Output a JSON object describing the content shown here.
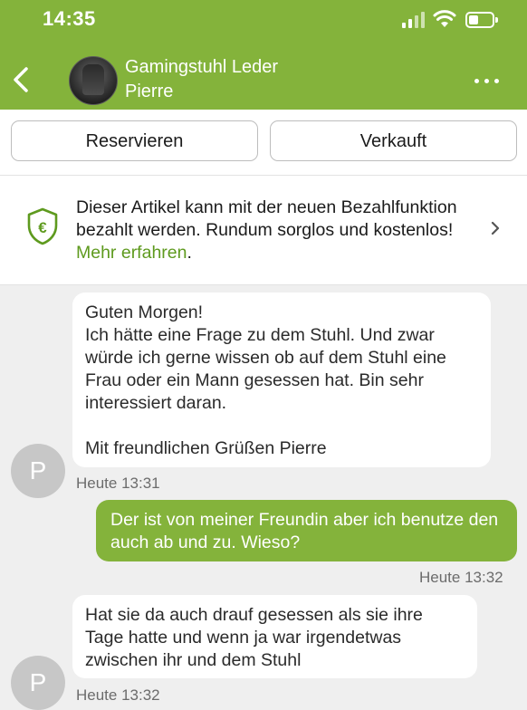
{
  "status_bar": {
    "time": "14:35"
  },
  "header": {
    "title": "Gamingstuhl Leder",
    "subtitle": "Pierre",
    "back_icon": "chevron-left-icon",
    "more_icon": "more-dots-icon"
  },
  "actions": {
    "reserve_label": "Reservieren",
    "sold_label": "Verkauft"
  },
  "payment_info": {
    "text": "Dieser Artikel kann mit der neuen Bezahlfunktion bezahlt werden. Rundum sorglos und kostenlos! ",
    "link": "Mehr erfahren",
    "period": ".",
    "icon": "euro-shield-icon"
  },
  "messages": [
    {
      "direction": "incoming",
      "text": "Guten Morgen!\nIch hätte eine Frage zu dem Stuhl. Und zwar würde ich gerne wissen ob auf dem Stuhl eine Frau oder ein Mann gesessen hat. Bin sehr interessiert daran.\n\nMit freundlichen Grüßen Pierre",
      "time": "Heute 13:31",
      "avatar_letter": "P"
    },
    {
      "direction": "outgoing",
      "text": "Der ist von meiner Freundin aber ich benutze den auch ab und zu. Wieso?",
      "time": "Heute 13:32"
    },
    {
      "direction": "incoming",
      "text": "Hat sie da auch drauf gesessen als sie ihre Tage hatte und wenn ja war irgendetwas zwischen ihr und dem Stuhl",
      "time": "Heute 13:32",
      "avatar_letter": "P"
    }
  ],
  "colors": {
    "brand_green": "#84b33b",
    "link_green": "#5e9a1e",
    "chat_background": "#efefef"
  }
}
